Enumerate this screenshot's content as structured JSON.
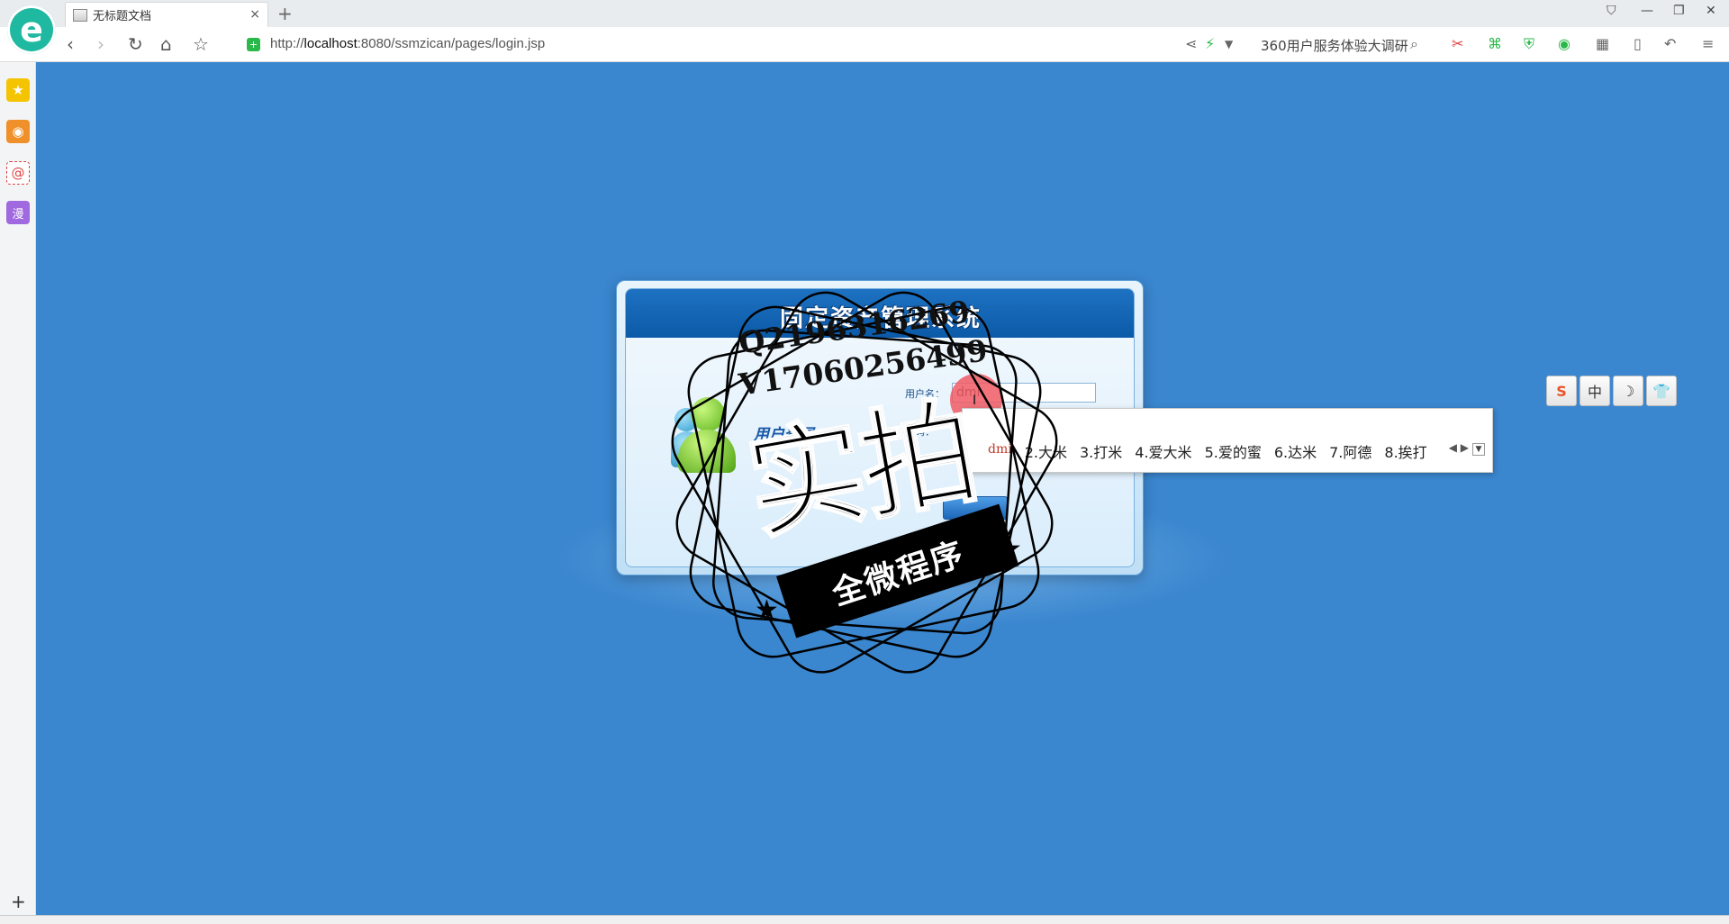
{
  "browser": {
    "tab_title": "无标题文档",
    "url_prefix": "http://",
    "url_host": "localhost",
    "url_rest": ":8080/ssmzican/pages/login.jsp",
    "search_hint": "360用户服务体验大调研"
  },
  "icons": {
    "logo": "e",
    "tab_close": "×",
    "new_tab": "+",
    "back": "‹",
    "forward": "›",
    "reload": "↻",
    "home": "⌂",
    "star": "☆",
    "sidebar_add": "+"
  },
  "login": {
    "system_title": "固定资产管理系统",
    "section_label": "用户登录",
    "username_label": "用户名：",
    "username_value": "dmi",
    "password_label": "密码：",
    "password_value": ""
  },
  "ime": {
    "composition": "dmi",
    "candidates": [
      "2.大米",
      "3.打米",
      "4.爱大米",
      "5.爱的蜜",
      "6.达米",
      "7.阿德",
      "8.挨打"
    ]
  },
  "float_toolbar": {
    "items": [
      "S",
      "中",
      "☽",
      "👕"
    ]
  },
  "watermark": {
    "line1": "Q2196316269",
    "line2": "V17060256499",
    "big": "实拍",
    "ribbon": "全微程序"
  },
  "colors": {
    "page_bg": "#3a86cf",
    "header_blue": "#0b5aa8",
    "ime_first": "#c0392b",
    "cursor_marker": "#f05a64"
  }
}
